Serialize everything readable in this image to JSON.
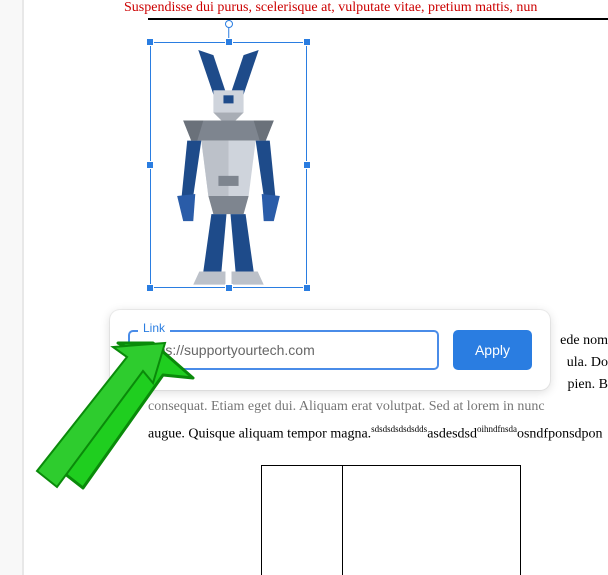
{
  "red_heading": "Suspendisse dui purus, scelerisque at, vulputate vitae, pretium mattis, nun",
  "link_popup": {
    "label": "Link",
    "input_value": "https://supportyourtech.com",
    "apply_label": "Apply"
  },
  "body_lines": {
    "r1": "ede nom",
    "r2": "ula. Do",
    "r3": "pien. B",
    "full1_a": "consequat. Etiam eget dui. Aliquam erat volutpat. Sed at lorem in nunc ",
    "full2_a": "augue. Quisque aliquam tempor magna.",
    "sup1": "sdsdsdsdsdsdds",
    "full2_b": "asdesdsd",
    "sup2": "oihndfnsda",
    "full2_c": "osndfponsdpon"
  }
}
